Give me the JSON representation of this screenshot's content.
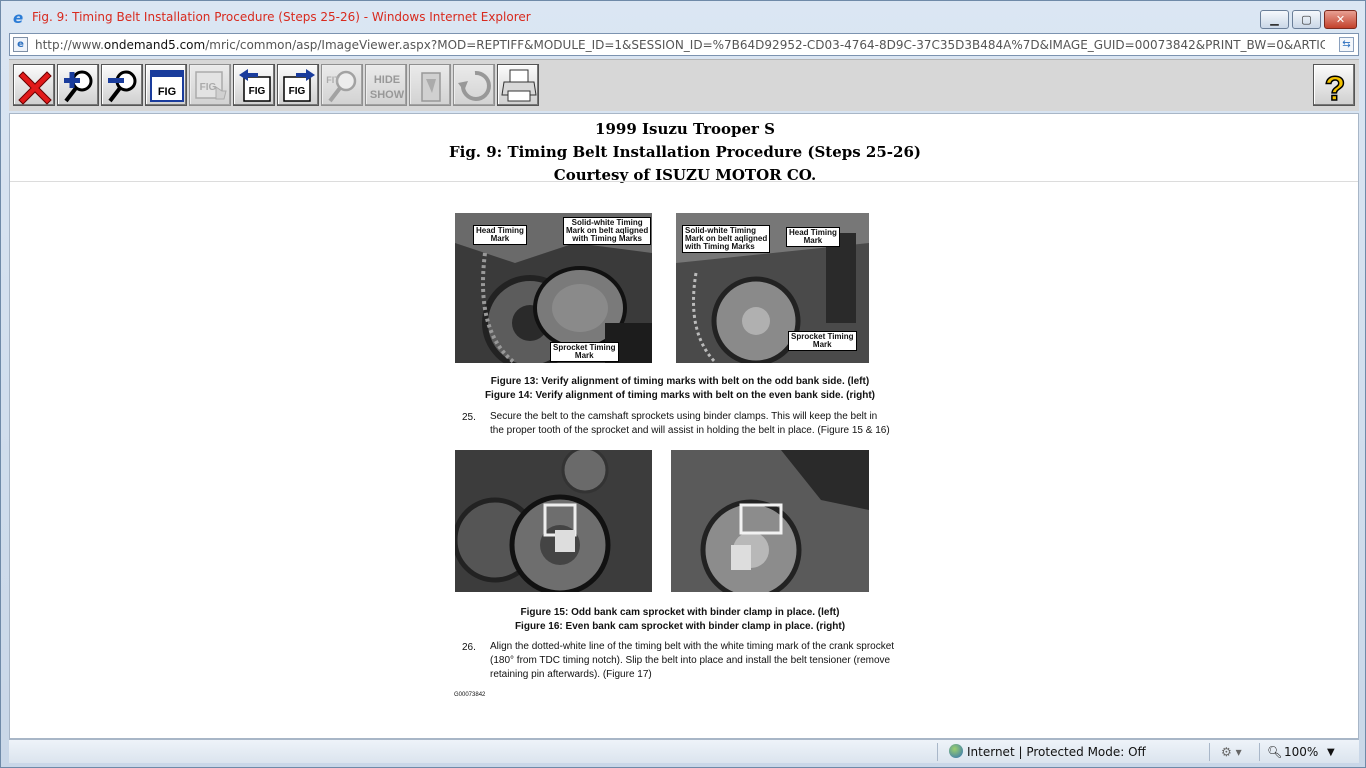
{
  "window": {
    "title": "Fig. 9: Timing Belt Installation Procedure (Steps 25-26) - Windows Internet Explorer",
    "min_label": "▁",
    "max_label": "▢",
    "close_label": "✕"
  },
  "address": {
    "prefix": "http://www.",
    "domain": "ondemand5.com",
    "path": "/mric/common/asp/ImageViewer.aspx?MOD=REPTIFF&MODULE_ID=1&SESSION_ID=%7B64D92952-CD03-4764-8D9C-37C35D3B484A%7D&IMAGE_GUID=00073842&PRINT_BW=0&ARTICLE_TITLE=TIMING%20BELT%"
  },
  "toolbar": {
    "buttons": [
      {
        "name": "close-figure-button",
        "icon": "red-x-icon"
      },
      {
        "name": "zoom-in-button",
        "icon": "zoom-in-icon"
      },
      {
        "name": "zoom-out-button",
        "icon": "zoom-out-icon"
      },
      {
        "name": "fig-window-button",
        "icon": "fig-window-icon",
        "label": "FIG"
      },
      {
        "name": "fig-pan-button",
        "icon": "fig-hand-icon",
        "label": "FIG"
      },
      {
        "name": "previous-fig-button",
        "icon": "prev-fig-icon",
        "label": "FIG"
      },
      {
        "name": "next-fig-button",
        "icon": "next-fig-icon",
        "label": "FIG"
      },
      {
        "name": "fit-button",
        "icon": "fit-magnifier-icon",
        "label": "FIT"
      },
      {
        "name": "hide-show-button",
        "icon": "hide-show-icon",
        "label_top": "HIDE",
        "label_bottom": "SHOW"
      },
      {
        "name": "clear-button",
        "icon": "eraser-icon"
      },
      {
        "name": "rotate-button",
        "icon": "rotate-icon"
      },
      {
        "name": "print-button",
        "icon": "printer-icon"
      }
    ],
    "help_label": "?"
  },
  "header": {
    "vehicle": "1999 Isuzu Trooper S",
    "figure_title": "Fig. 9: Timing Belt Installation Procedure (Steps 25-26)",
    "courtesy": "Courtesy of ISUZU MOTOR CO."
  },
  "document": {
    "photo13": {
      "head_mark": [
        "Head Timing",
        "Mark"
      ],
      "belt_mark": [
        "Solid-white Timing",
        "Mark on belt aqligned",
        "with Timing Marks"
      ],
      "sprocket_mark": [
        "Sprocket Timing",
        "Mark"
      ]
    },
    "photo14": {
      "belt_mark": [
        "Solid-white Timing",
        "Mark on belt aqligned",
        "with Timing Marks"
      ],
      "head_mark": [
        "Head Timing",
        "Mark"
      ],
      "sprocket_mark": [
        "Sprocket Timing",
        "Mark"
      ]
    },
    "caption13": "Figure 13: Verify alignment of timing marks with belt on the odd bank side. (left)",
    "caption14": "Figure 14: Verify alignment of timing marks with belt on the even bank side. (right)",
    "step25_num": "25.",
    "step25_line1": "Secure the belt to the camshaft sprockets using binder clamps.  This will keep the belt in",
    "step25_line2": "the proper tooth of the sprocket and will assist in holding the belt in place.  (Figure 15 & 16)",
    "caption15": "Figure 15: Odd bank cam sprocket with binder clamp in place. (left)",
    "caption16": "Figure 16: Even bank cam sprocket with binder clamp in place. (right)",
    "step26_num": "26.",
    "step26_line1": "Align the dotted-white line of the timing belt with the white timing mark of the crank sprocket",
    "step26_line2": "(180° from TDC timing notch).  Slip the belt into place and install the belt tensioner (remove",
    "step26_line3": "retaining pin afterwards).  (Figure 17)",
    "doc_id": "G00073842"
  },
  "status": {
    "zone": "Internet | Protected Mode: Off",
    "zoom": "100%"
  }
}
